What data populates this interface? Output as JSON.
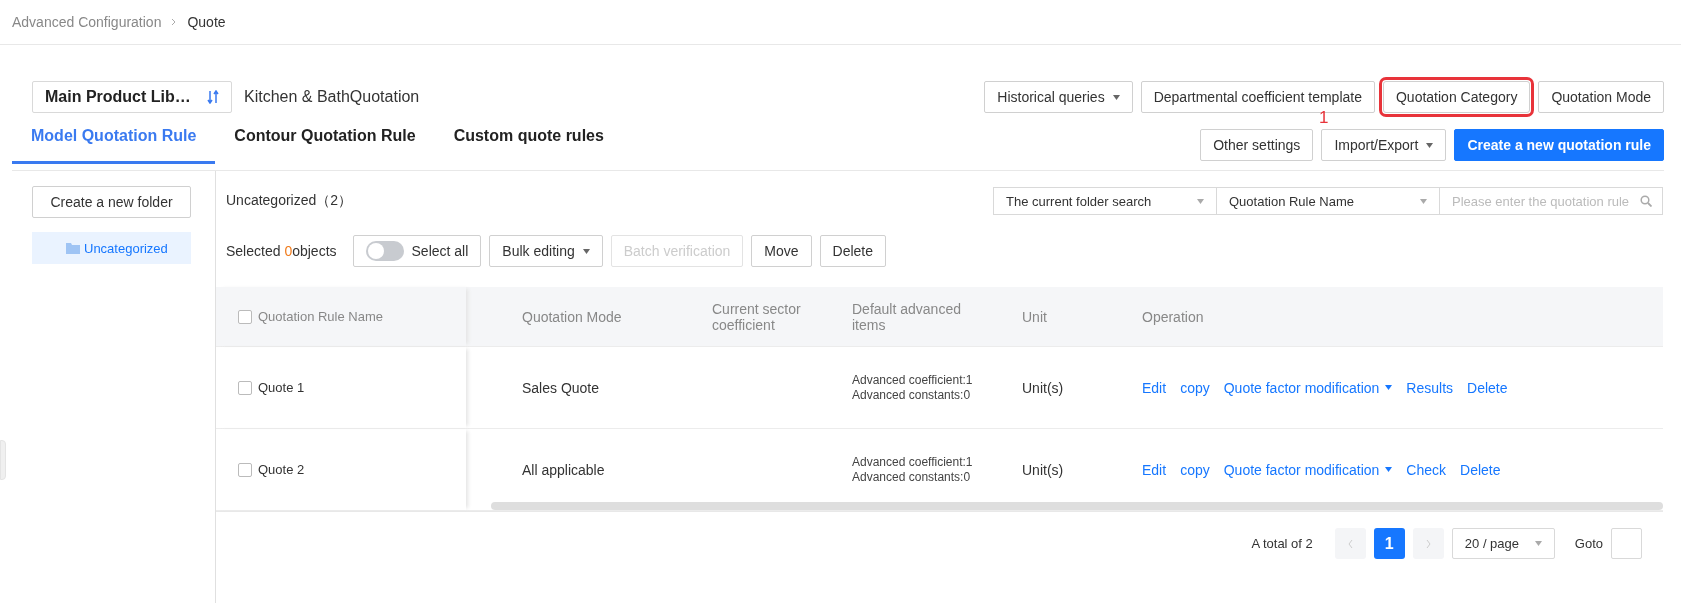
{
  "breadcrumb": [
    "Advanced Configuration",
    "Quote"
  ],
  "library": {
    "label": "Main Product Lib…",
    "title": "Kitchen & BathQuotation"
  },
  "header_buttons": [
    {
      "label": "Historical queries",
      "kind": "dropdown",
      "highlighted": false
    },
    {
      "label": "Departmental coefficient template",
      "kind": "plain",
      "highlighted": false
    },
    {
      "label": "Quotation Category",
      "kind": "plain",
      "highlighted": true
    },
    {
      "label": "Quotation Mode",
      "kind": "plain",
      "highlighted": false
    }
  ],
  "annotation": {
    "label": "1"
  },
  "tabs": [
    {
      "label": "Model Quotation Rule",
      "selected": true
    },
    {
      "label": "Contour Quotation Rule",
      "selected": false
    },
    {
      "label": "Custom quote rules",
      "selected": false
    }
  ],
  "actions": [
    {
      "label": "Other settings",
      "kind": "plain"
    },
    {
      "label": "Import/Export",
      "kind": "dropdown"
    },
    {
      "label": "Create a new quotation rule",
      "kind": "primary"
    }
  ],
  "sidebar": {
    "create_button": "Create a new folder",
    "folders": [
      {
        "label": "Uncategorized",
        "selected": true
      }
    ]
  },
  "folder_heading": "Uncategorized（2）",
  "search": {
    "scope": "The current folder search",
    "field": "Quotation Rule Name",
    "placeholder": "Please enter the quotation rule"
  },
  "toolbar": {
    "selected_prefix": "Selected",
    "selected_count": "0",
    "selected_suffix": "objects",
    "select_all": {
      "label": "Select all",
      "on": false
    },
    "buttons": [
      {
        "label": "Bulk editing",
        "kind": "dropdown",
        "disabled": false
      },
      {
        "label": "Batch verification",
        "kind": "plain",
        "disabled": true
      },
      {
        "label": "Move",
        "kind": "plain",
        "disabled": false
      },
      {
        "label": "Delete",
        "kind": "plain",
        "disabled": false
      }
    ]
  },
  "table": {
    "columns": [
      "Quotation Rule Name",
      "Quotation Mode",
      "Current sector coefficient",
      "Default advanced items",
      "Unit",
      "Operation"
    ],
    "header_checked": false,
    "rows": [
      {
        "name": "Quote 1",
        "checked": false,
        "mode": "Sales Quote",
        "default_items": [
          "Advanced coefficient:1",
          "Advanced constants:0"
        ],
        "unit": "Unit(s)",
        "operations": [
          {
            "label": "Edit",
            "kind": "link"
          },
          {
            "label": "copy",
            "kind": "link"
          },
          {
            "label": "Quote factor modification",
            "kind": "dropdown"
          },
          {
            "label": "Results",
            "kind": "link"
          },
          {
            "label": "Delete",
            "kind": "link"
          }
        ]
      },
      {
        "name": "Quote 2",
        "checked": false,
        "mode": "All applicable",
        "default_items": [
          "Advanced coefficient:1",
          "Advanced constants:0"
        ],
        "unit": "Unit(s)",
        "operations": [
          {
            "label": "Edit",
            "kind": "link"
          },
          {
            "label": "copy",
            "kind": "link"
          },
          {
            "label": "Quote factor modification",
            "kind": "dropdown"
          },
          {
            "label": "Check",
            "kind": "link"
          },
          {
            "label": "Delete",
            "kind": "link"
          }
        ]
      }
    ]
  },
  "pagination": {
    "total": "A total of 2",
    "pages": [
      {
        "label": "1",
        "selected": true
      }
    ],
    "page_size": "20 / page",
    "goto": "Goto"
  }
}
